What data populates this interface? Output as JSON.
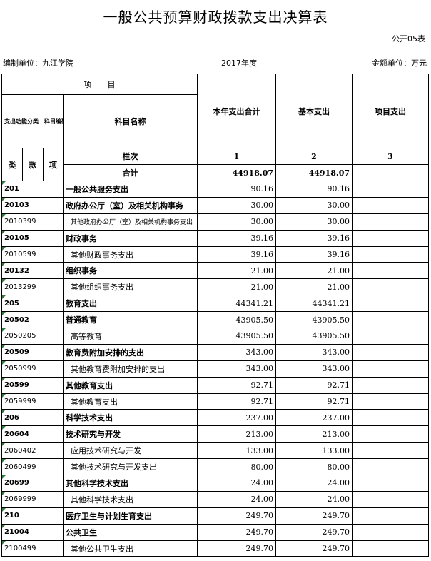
{
  "title": "一般公共预算财政拨款支出决算表",
  "form_no": "公开05表",
  "unit_label": "编制单位：九江学院",
  "year_label": "2017年度",
  "money_unit": "金额单位：万元",
  "header": {
    "project": "项　　目",
    "func_code": "支出功能分类　科目编码",
    "subject_name": "科目名称",
    "col_total": "本年支出合计",
    "col_basic": "基本支出",
    "col_project": "项目支出",
    "lei": "类",
    "kuan": "款",
    "xiang": "项",
    "lanci": "栏次",
    "col1": "1",
    "col2": "2",
    "col3": "3",
    "total_label": "合计",
    "total_sum": "44918.07",
    "total_basic": "44918.07",
    "total_project": ""
  },
  "rows": [
    {
      "code": "201",
      "name": "一般公共服务支出",
      "total": "90.16",
      "basic": "90.16",
      "project": "",
      "level": 1
    },
    {
      "code": "20103",
      "name": "政府办公厅（室）及相关机构事务",
      "total": "30.00",
      "basic": "30.00",
      "project": "",
      "level": 2
    },
    {
      "code": "2010399",
      "name": "其他政府办公厅（室）及相关机构事务支出",
      "total": "30.00",
      "basic": "30.00",
      "project": "",
      "level": 3
    },
    {
      "code": "20105",
      "name": "财政事务",
      "total": "39.16",
      "basic": "39.16",
      "project": "",
      "level": 2
    },
    {
      "code": "2010599",
      "name": "其他财政事务支出",
      "total": "39.16",
      "basic": "39.16",
      "project": "",
      "level": 3
    },
    {
      "code": "20132",
      "name": "组织事务",
      "total": "21.00",
      "basic": "21.00",
      "project": "",
      "level": 2
    },
    {
      "code": "2013299",
      "name": "其他组织事务支出",
      "total": "21.00",
      "basic": "21.00",
      "project": "",
      "level": 3
    },
    {
      "code": "205",
      "name": "教育支出",
      "total": "44341.21",
      "basic": "44341.21",
      "project": "",
      "level": 1
    },
    {
      "code": "20502",
      "name": "普通教育",
      "total": "43905.50",
      "basic": "43905.50",
      "project": "",
      "level": 2
    },
    {
      "code": "2050205",
      "name": "高等教育",
      "total": "43905.50",
      "basic": "43905.50",
      "project": "",
      "level": 3
    },
    {
      "code": "20509",
      "name": "教育费附加安排的支出",
      "total": "343.00",
      "basic": "343.00",
      "project": "",
      "level": 2
    },
    {
      "code": "2050999",
      "name": "其他教育费附加安排的支出",
      "total": "343.00",
      "basic": "343.00",
      "project": "",
      "level": 3
    },
    {
      "code": "20599",
      "name": "其他教育支出",
      "total": "92.71",
      "basic": "92.71",
      "project": "",
      "level": 2
    },
    {
      "code": "2059999",
      "name": "其他教育支出",
      "total": "92.71",
      "basic": "92.71",
      "project": "",
      "level": 3
    },
    {
      "code": "206",
      "name": "科学技术支出",
      "total": "237.00",
      "basic": "237.00",
      "project": "",
      "level": 1
    },
    {
      "code": "20604",
      "name": "技术研究与开发",
      "total": "213.00",
      "basic": "213.00",
      "project": "",
      "level": 2
    },
    {
      "code": "2060402",
      "name": "应用技术研究与开发",
      "total": "133.00",
      "basic": "133.00",
      "project": "",
      "level": 3
    },
    {
      "code": "2060499",
      "name": "其他技术研究与开发支出",
      "total": "80.00",
      "basic": "80.00",
      "project": "",
      "level": 3
    },
    {
      "code": "20699",
      "name": "其他科学技术支出",
      "total": "24.00",
      "basic": "24.00",
      "project": "",
      "level": 2
    },
    {
      "code": "2069999",
      "name": "其他科学技术支出",
      "total": "24.00",
      "basic": "24.00",
      "project": "",
      "level": 3
    },
    {
      "code": "210",
      "name": "医疗卫生与计划生育支出",
      "total": "249.70",
      "basic": "249.70",
      "project": "",
      "level": 1
    },
    {
      "code": "21004",
      "name": "公共卫生",
      "total": "249.70",
      "basic": "249.70",
      "project": "",
      "level": 2
    },
    {
      "code": "2100499",
      "name": "其他公共卫生支出",
      "total": "249.70",
      "basic": "249.70",
      "project": "",
      "level": 3
    }
  ]
}
